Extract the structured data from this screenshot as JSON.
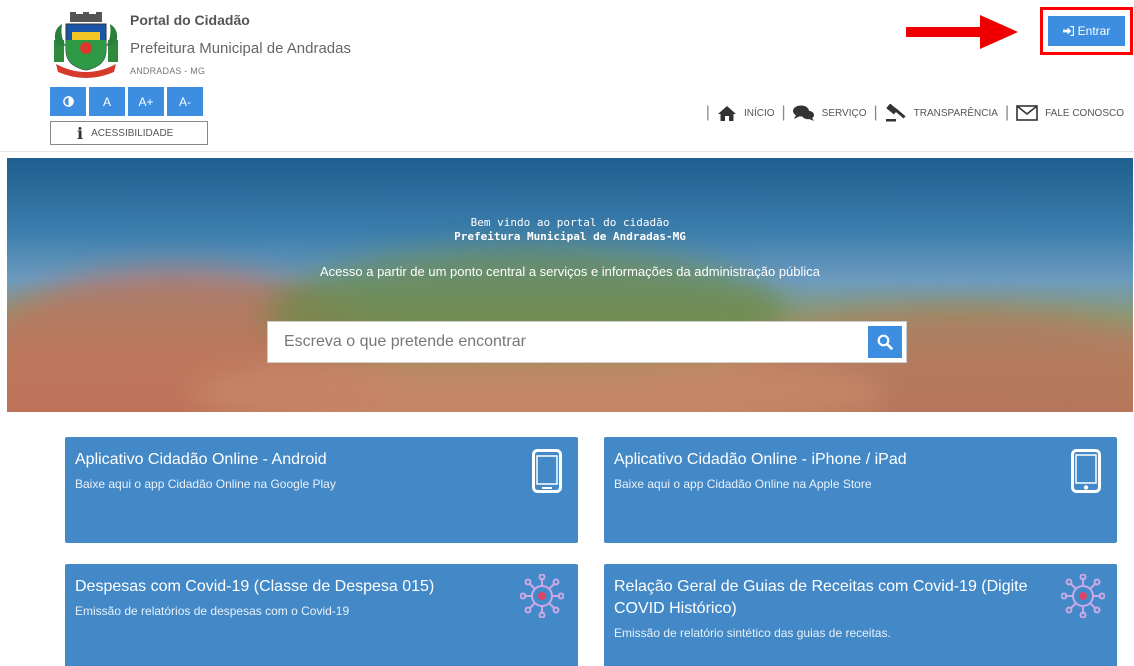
{
  "header": {
    "title": "Portal do Cidadão",
    "subtitle": "Prefeitura Municipal de Andradas",
    "city": "ANDRADAS - MG",
    "login_label": "Entrar"
  },
  "accessibility": {
    "buttons": [
      "A",
      "A+",
      "A-"
    ],
    "label": "ACESSIBILIDADE"
  },
  "nav": {
    "items": [
      {
        "label": "INÍCIO",
        "icon": "home-icon"
      },
      {
        "label": "SERVIÇO",
        "icon": "chat-bubbles-icon"
      },
      {
        "label": "TRANSPARÊNCIA",
        "icon": "gavel-icon"
      },
      {
        "label": "FALE CONOSCO",
        "icon": "envelope-icon"
      }
    ]
  },
  "hero": {
    "welcome_line1": "Bem vindo ao portal do cidadão",
    "welcome_line2": "Prefeitura Municipal de Andradas-MG",
    "tagline": "Acesso a partir de um ponto central a serviços e informações da administração pública",
    "search_placeholder": "Escreva o que pretende encontrar"
  },
  "cards": [
    {
      "title": "Aplicativo Cidadão Online - Android",
      "desc": "Baixe aqui o app Cidadão Online na Google Play",
      "icon": "android-phone-icon"
    },
    {
      "title": "Aplicativo Cidadão Online - iPhone / iPad",
      "desc": "Baixe aqui o app Cidadão Online na Apple Store",
      "icon": "iphone-icon"
    },
    {
      "title": "Despesas com Covid-19 (Classe de Despesa 015)",
      "desc": "Emissão de relatórios de despesas com o Covid-19",
      "icon": "virus-icon"
    },
    {
      "title": "Relação Geral de Guias de Receitas com Covid-19 (Digite COVID Histórico)",
      "desc": "Emissão de relatório sintético das guias de receitas.",
      "icon": "virus-icon"
    }
  ],
  "colors": {
    "primary": "#3d8ee0",
    "card": "#4489c7",
    "highlight": "#ff0000"
  }
}
